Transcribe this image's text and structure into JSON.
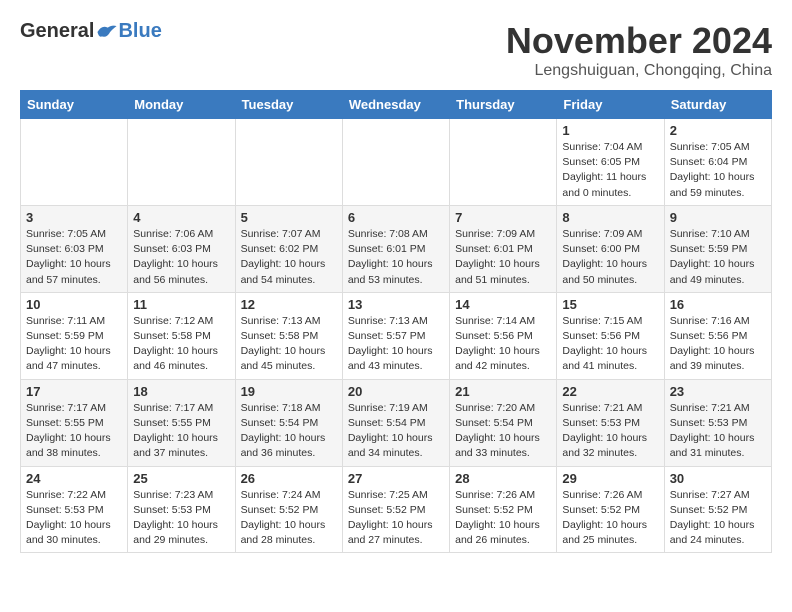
{
  "header": {
    "logo": {
      "general": "General",
      "blue": "Blue",
      "tagline": ""
    },
    "title": "November 2024",
    "location": "Lengshuiguan, Chongqing, China"
  },
  "weekdays": [
    "Sunday",
    "Monday",
    "Tuesday",
    "Wednesday",
    "Thursday",
    "Friday",
    "Saturday"
  ],
  "weeks": [
    [
      {
        "day": "",
        "info": ""
      },
      {
        "day": "",
        "info": ""
      },
      {
        "day": "",
        "info": ""
      },
      {
        "day": "",
        "info": ""
      },
      {
        "day": "",
        "info": ""
      },
      {
        "day": "1",
        "info": "Sunrise: 7:04 AM\nSunset: 6:05 PM\nDaylight: 11 hours and 0 minutes."
      },
      {
        "day": "2",
        "info": "Sunrise: 7:05 AM\nSunset: 6:04 PM\nDaylight: 10 hours and 59 minutes."
      }
    ],
    [
      {
        "day": "3",
        "info": "Sunrise: 7:05 AM\nSunset: 6:03 PM\nDaylight: 10 hours and 57 minutes."
      },
      {
        "day": "4",
        "info": "Sunrise: 7:06 AM\nSunset: 6:03 PM\nDaylight: 10 hours and 56 minutes."
      },
      {
        "day": "5",
        "info": "Sunrise: 7:07 AM\nSunset: 6:02 PM\nDaylight: 10 hours and 54 minutes."
      },
      {
        "day": "6",
        "info": "Sunrise: 7:08 AM\nSunset: 6:01 PM\nDaylight: 10 hours and 53 minutes."
      },
      {
        "day": "7",
        "info": "Sunrise: 7:09 AM\nSunset: 6:01 PM\nDaylight: 10 hours and 51 minutes."
      },
      {
        "day": "8",
        "info": "Sunrise: 7:09 AM\nSunset: 6:00 PM\nDaylight: 10 hours and 50 minutes."
      },
      {
        "day": "9",
        "info": "Sunrise: 7:10 AM\nSunset: 5:59 PM\nDaylight: 10 hours and 49 minutes."
      }
    ],
    [
      {
        "day": "10",
        "info": "Sunrise: 7:11 AM\nSunset: 5:59 PM\nDaylight: 10 hours and 47 minutes."
      },
      {
        "day": "11",
        "info": "Sunrise: 7:12 AM\nSunset: 5:58 PM\nDaylight: 10 hours and 46 minutes."
      },
      {
        "day": "12",
        "info": "Sunrise: 7:13 AM\nSunset: 5:58 PM\nDaylight: 10 hours and 45 minutes."
      },
      {
        "day": "13",
        "info": "Sunrise: 7:13 AM\nSunset: 5:57 PM\nDaylight: 10 hours and 43 minutes."
      },
      {
        "day": "14",
        "info": "Sunrise: 7:14 AM\nSunset: 5:56 PM\nDaylight: 10 hours and 42 minutes."
      },
      {
        "day": "15",
        "info": "Sunrise: 7:15 AM\nSunset: 5:56 PM\nDaylight: 10 hours and 41 minutes."
      },
      {
        "day": "16",
        "info": "Sunrise: 7:16 AM\nSunset: 5:56 PM\nDaylight: 10 hours and 39 minutes."
      }
    ],
    [
      {
        "day": "17",
        "info": "Sunrise: 7:17 AM\nSunset: 5:55 PM\nDaylight: 10 hours and 38 minutes."
      },
      {
        "day": "18",
        "info": "Sunrise: 7:17 AM\nSunset: 5:55 PM\nDaylight: 10 hours and 37 minutes."
      },
      {
        "day": "19",
        "info": "Sunrise: 7:18 AM\nSunset: 5:54 PM\nDaylight: 10 hours and 36 minutes."
      },
      {
        "day": "20",
        "info": "Sunrise: 7:19 AM\nSunset: 5:54 PM\nDaylight: 10 hours and 34 minutes."
      },
      {
        "day": "21",
        "info": "Sunrise: 7:20 AM\nSunset: 5:54 PM\nDaylight: 10 hours and 33 minutes."
      },
      {
        "day": "22",
        "info": "Sunrise: 7:21 AM\nSunset: 5:53 PM\nDaylight: 10 hours and 32 minutes."
      },
      {
        "day": "23",
        "info": "Sunrise: 7:21 AM\nSunset: 5:53 PM\nDaylight: 10 hours and 31 minutes."
      }
    ],
    [
      {
        "day": "24",
        "info": "Sunrise: 7:22 AM\nSunset: 5:53 PM\nDaylight: 10 hours and 30 minutes."
      },
      {
        "day": "25",
        "info": "Sunrise: 7:23 AM\nSunset: 5:53 PM\nDaylight: 10 hours and 29 minutes."
      },
      {
        "day": "26",
        "info": "Sunrise: 7:24 AM\nSunset: 5:52 PM\nDaylight: 10 hours and 28 minutes."
      },
      {
        "day": "27",
        "info": "Sunrise: 7:25 AM\nSunset: 5:52 PM\nDaylight: 10 hours and 27 minutes."
      },
      {
        "day": "28",
        "info": "Sunrise: 7:26 AM\nSunset: 5:52 PM\nDaylight: 10 hours and 26 minutes."
      },
      {
        "day": "29",
        "info": "Sunrise: 7:26 AM\nSunset: 5:52 PM\nDaylight: 10 hours and 25 minutes."
      },
      {
        "day": "30",
        "info": "Sunrise: 7:27 AM\nSunset: 5:52 PM\nDaylight: 10 hours and 24 minutes."
      }
    ]
  ]
}
